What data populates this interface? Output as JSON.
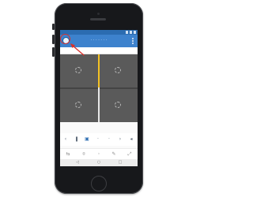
{
  "device": {
    "model_icon": "iphone-icon"
  },
  "app_bar": {
    "title": "· · · · · · ·",
    "logo_icon": "app-logo-icon",
    "menu_icon": "overflow-menu-icon"
  },
  "video_grid": {
    "cells": [
      {
        "icon": "loading-spinner-icon"
      },
      {
        "icon": "loading-spinner-icon"
      },
      {
        "icon": "loading-spinner-icon"
      },
      {
        "icon": "loading-spinner-icon"
      }
    ],
    "selected_highlight_color": "#f3c224"
  },
  "controls_row_1": {
    "items": [
      {
        "icon": "back-icon",
        "glyph": "‹"
      },
      {
        "icon": "pause-icon",
        "glyph": "❚"
      },
      {
        "icon": "layout-icon",
        "glyph": "▣"
      },
      {
        "icon": "dots-icon",
        "glyph": "·"
      },
      {
        "icon": "dots-icon",
        "glyph": "·"
      },
      {
        "icon": "forward-icon",
        "glyph": "›"
      },
      {
        "icon": "volume-icon",
        "glyph": "◂"
      }
    ]
  },
  "controls_row_2": {
    "items": [
      {
        "icon": "ptz-icon",
        "glyph": "⇆"
      },
      {
        "icon": "capture-icon",
        "glyph": "⌾"
      },
      {
        "icon": "record-icon",
        "glyph": "◦"
      },
      {
        "icon": "edit-icon",
        "glyph": "✎"
      },
      {
        "icon": "share-icon",
        "glyph": "⤢"
      }
    ]
  },
  "android_nav": {
    "items": [
      {
        "icon": "nav-back-icon",
        "glyph": "◁"
      },
      {
        "icon": "nav-home-icon",
        "glyph": "○"
      },
      {
        "icon": "nav-recents-icon",
        "glyph": "□"
      }
    ]
  },
  "annotation": {
    "color": "#d9312b",
    "target": "app-logo"
  },
  "colors": {
    "status_bar": "#2b6cb1",
    "app_bar": "#3d82cd",
    "grid_background": "#3a3a3a",
    "cell": "#5a5a5a",
    "phone_body": "#17181b"
  }
}
